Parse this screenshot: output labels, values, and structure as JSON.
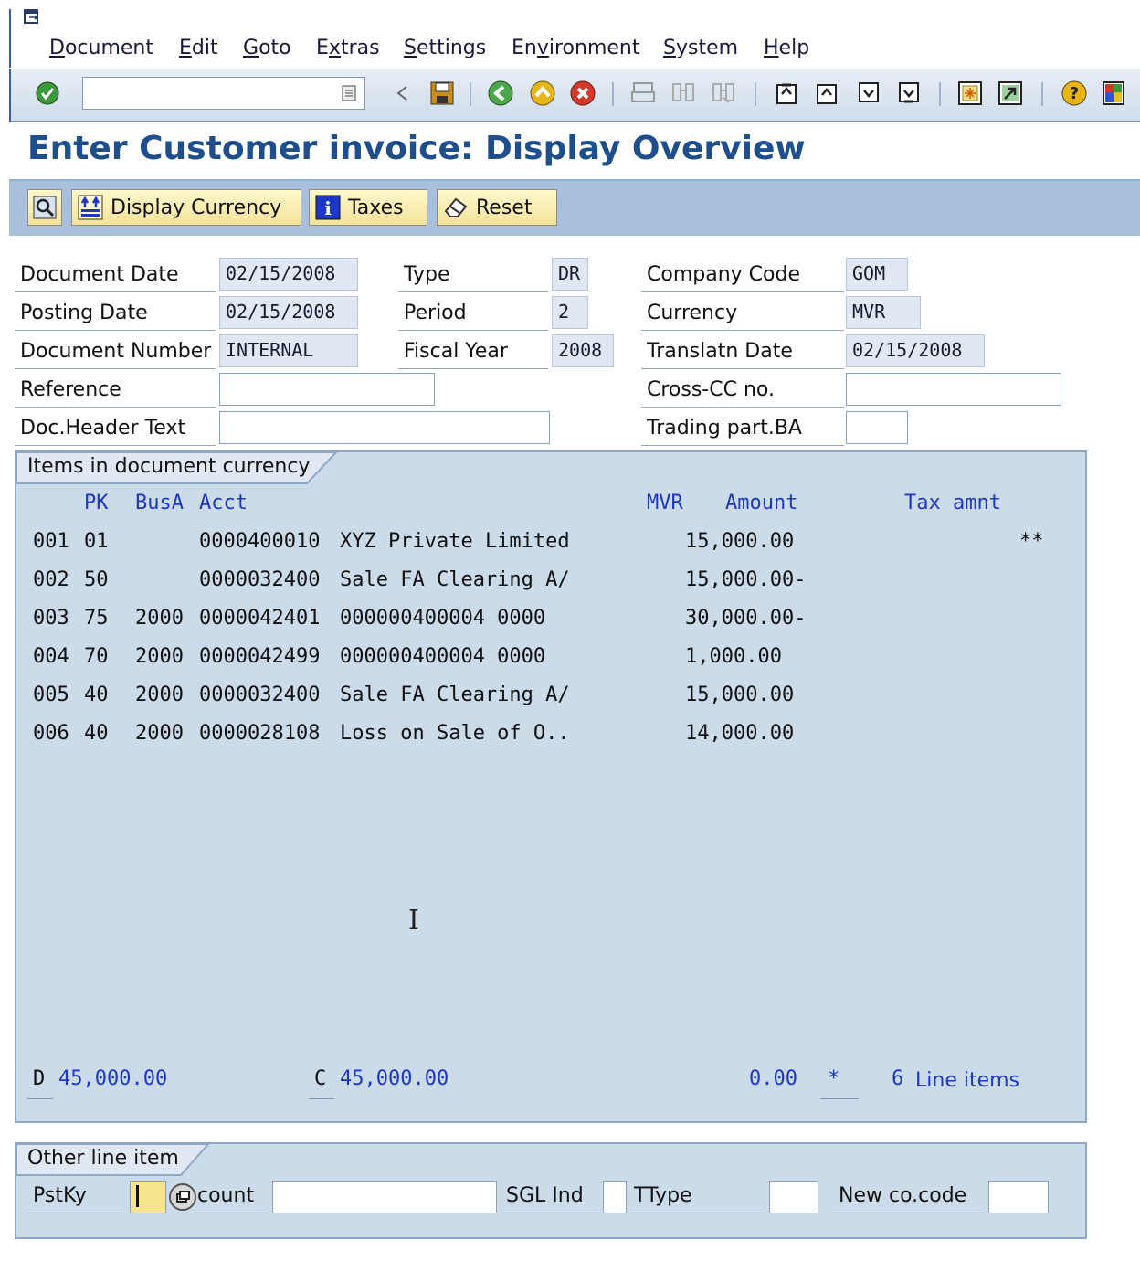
{
  "menu": {
    "items": [
      "Document",
      "Edit",
      "Goto",
      "Extras",
      "Settings",
      "Environment",
      "System",
      "Help"
    ],
    "underline_chars": [
      "D",
      "E",
      "G",
      "x",
      "S",
      "v",
      "S",
      "H"
    ]
  },
  "toolbar": {
    "command_field_value": "",
    "icons": [
      "enter-check-icon",
      "command-dropdown-icon",
      "back-arrow-small-icon",
      "save-icon",
      "back-icon",
      "exit-icon",
      "cancel-icon",
      "print-icon",
      "find-icon",
      "find-next-icon",
      "first-page-icon",
      "previous-page-icon",
      "next-page-icon",
      "last-page-icon",
      "create-session-icon",
      "shortcut-icon",
      "help-icon",
      "customize-layout-icon"
    ]
  },
  "page": {
    "title": "Enter Customer invoice: Display Overview"
  },
  "app_toolbar": {
    "buttons": [
      {
        "name": "choose-detail-button",
        "label": ""
      },
      {
        "name": "display-currency-button",
        "label": "Display Currency"
      },
      {
        "name": "taxes-button",
        "label": "Taxes"
      },
      {
        "name": "reset-button",
        "label": "Reset"
      }
    ]
  },
  "header": {
    "document_date": {
      "label": "Document Date",
      "value": "02/15/2008"
    },
    "posting_date": {
      "label": "Posting Date",
      "value": "02/15/2008"
    },
    "document_number": {
      "label": "Document Number",
      "value": "INTERNAL"
    },
    "reference": {
      "label": "Reference",
      "value": ""
    },
    "doc_header_text": {
      "label": "Doc.Header Text",
      "value": ""
    },
    "type": {
      "label": "Type",
      "value": "DR"
    },
    "period": {
      "label": "Period",
      "value": "2"
    },
    "fiscal_year": {
      "label": "Fiscal Year",
      "value": "2008"
    },
    "company_code": {
      "label": "Company Code",
      "value": "GOM"
    },
    "currency": {
      "label": "Currency",
      "value": "MVR"
    },
    "translation_date": {
      "label": "Translatn Date",
      "value": "02/15/2008"
    },
    "cross_cc": {
      "label": "Cross-CC no.",
      "value": ""
    },
    "trading_part": {
      "label": "Trading part.BA",
      "value": ""
    }
  },
  "items": {
    "group_title": "Items in document currency",
    "columns": {
      "pk": "PK",
      "busa": "BusA",
      "acct": "Acct",
      "currency": "MVR",
      "amount": "Amount",
      "tax": "Tax amnt"
    },
    "rows": [
      {
        "no": "001",
        "pk": "01",
        "busa": "",
        "acct": "0000400010",
        "text": "XYZ Private Limited",
        "amount": "15,000.00",
        "tax": "**"
      },
      {
        "no": "002",
        "pk": "50",
        "busa": "",
        "acct": "0000032400",
        "text": "Sale FA Clearing A/",
        "amount": "15,000.00-",
        "tax": ""
      },
      {
        "no": "003",
        "pk": "75",
        "busa": "2000",
        "acct": "0000042401",
        "text": "000000400004 0000",
        "amount": "30,000.00-",
        "tax": ""
      },
      {
        "no": "004",
        "pk": "70",
        "busa": "2000",
        "acct": "0000042499",
        "text": "000000400004 0000",
        "amount": "1,000.00",
        "tax": ""
      },
      {
        "no": "005",
        "pk": "40",
        "busa": "2000",
        "acct": "0000032400",
        "text": "Sale FA Clearing A/",
        "amount": "15,000.00",
        "tax": ""
      },
      {
        "no": "006",
        "pk": "40",
        "busa": "2000",
        "acct": "0000028108",
        "text": "Loss on Sale of O..",
        "amount": "14,000.00",
        "tax": ""
      }
    ],
    "totals": {
      "debit_label": "D",
      "debit": "45,000.00",
      "credit_label": "C",
      "credit": "45,000.00",
      "balance": "0.00",
      "balance_marker": "*",
      "line_count": "6",
      "line_items_label": "Line items"
    }
  },
  "other_line_item": {
    "group_title": "Other line item",
    "pstky_label": "PstKy",
    "pstky_value": "",
    "account_label": "count",
    "account_value": "",
    "sgl_label": "SGL Ind",
    "sgl_value": "",
    "ttype_label": "TType",
    "ttype_value": "",
    "new_co_label": "New co.code",
    "new_co_value": ""
  },
  "colors": {
    "title": "#1f4e8c",
    "column_header": "#1d37c9",
    "group_bg": "#ccdbea",
    "app_toolbar": "#a8c0dc"
  }
}
